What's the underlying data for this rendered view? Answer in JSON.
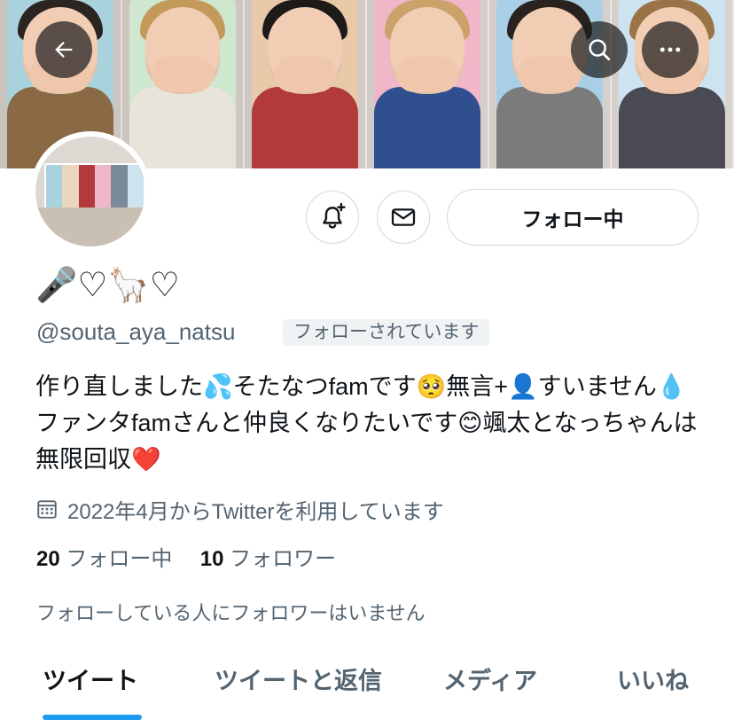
{
  "header": {
    "back_icon": "arrow-left-icon",
    "search_icon": "search-icon",
    "more_icon": "more-horizontal-icon"
  },
  "profile": {
    "display_name": "🎤♡🦙♡",
    "handle": "@souta_aya_natsu",
    "follows_you_badge": "フォローされています",
    "bio": "作り直しました💦そたなつfamです🥺無言+👤すいません💧ファンタfamさんと仲良くなりたいです😊颯太となっちゃんは無限回収❤️",
    "joined": "2022年4月からTwitterを利用しています",
    "following_count": "20",
    "following_label": "フォロー中",
    "followers_count": "10",
    "followers_label": "フォロワー",
    "followers_you_know": "フォローしている人にフォロワーはいません"
  },
  "actions": {
    "notify_icon": "bell-plus-icon",
    "message_icon": "mail-icon",
    "follow_button_label": "フォロー中"
  },
  "tabs": [
    {
      "label": "ツイート",
      "active": true
    },
    {
      "label": "ツイートと返信",
      "active": false
    },
    {
      "label": "メディア",
      "active": false
    },
    {
      "label": "いいね",
      "active": false
    }
  ],
  "colors": {
    "accent": "#1d9bf0",
    "text": "#0f1419",
    "secondary": "#536471",
    "border": "#cfd9de"
  }
}
